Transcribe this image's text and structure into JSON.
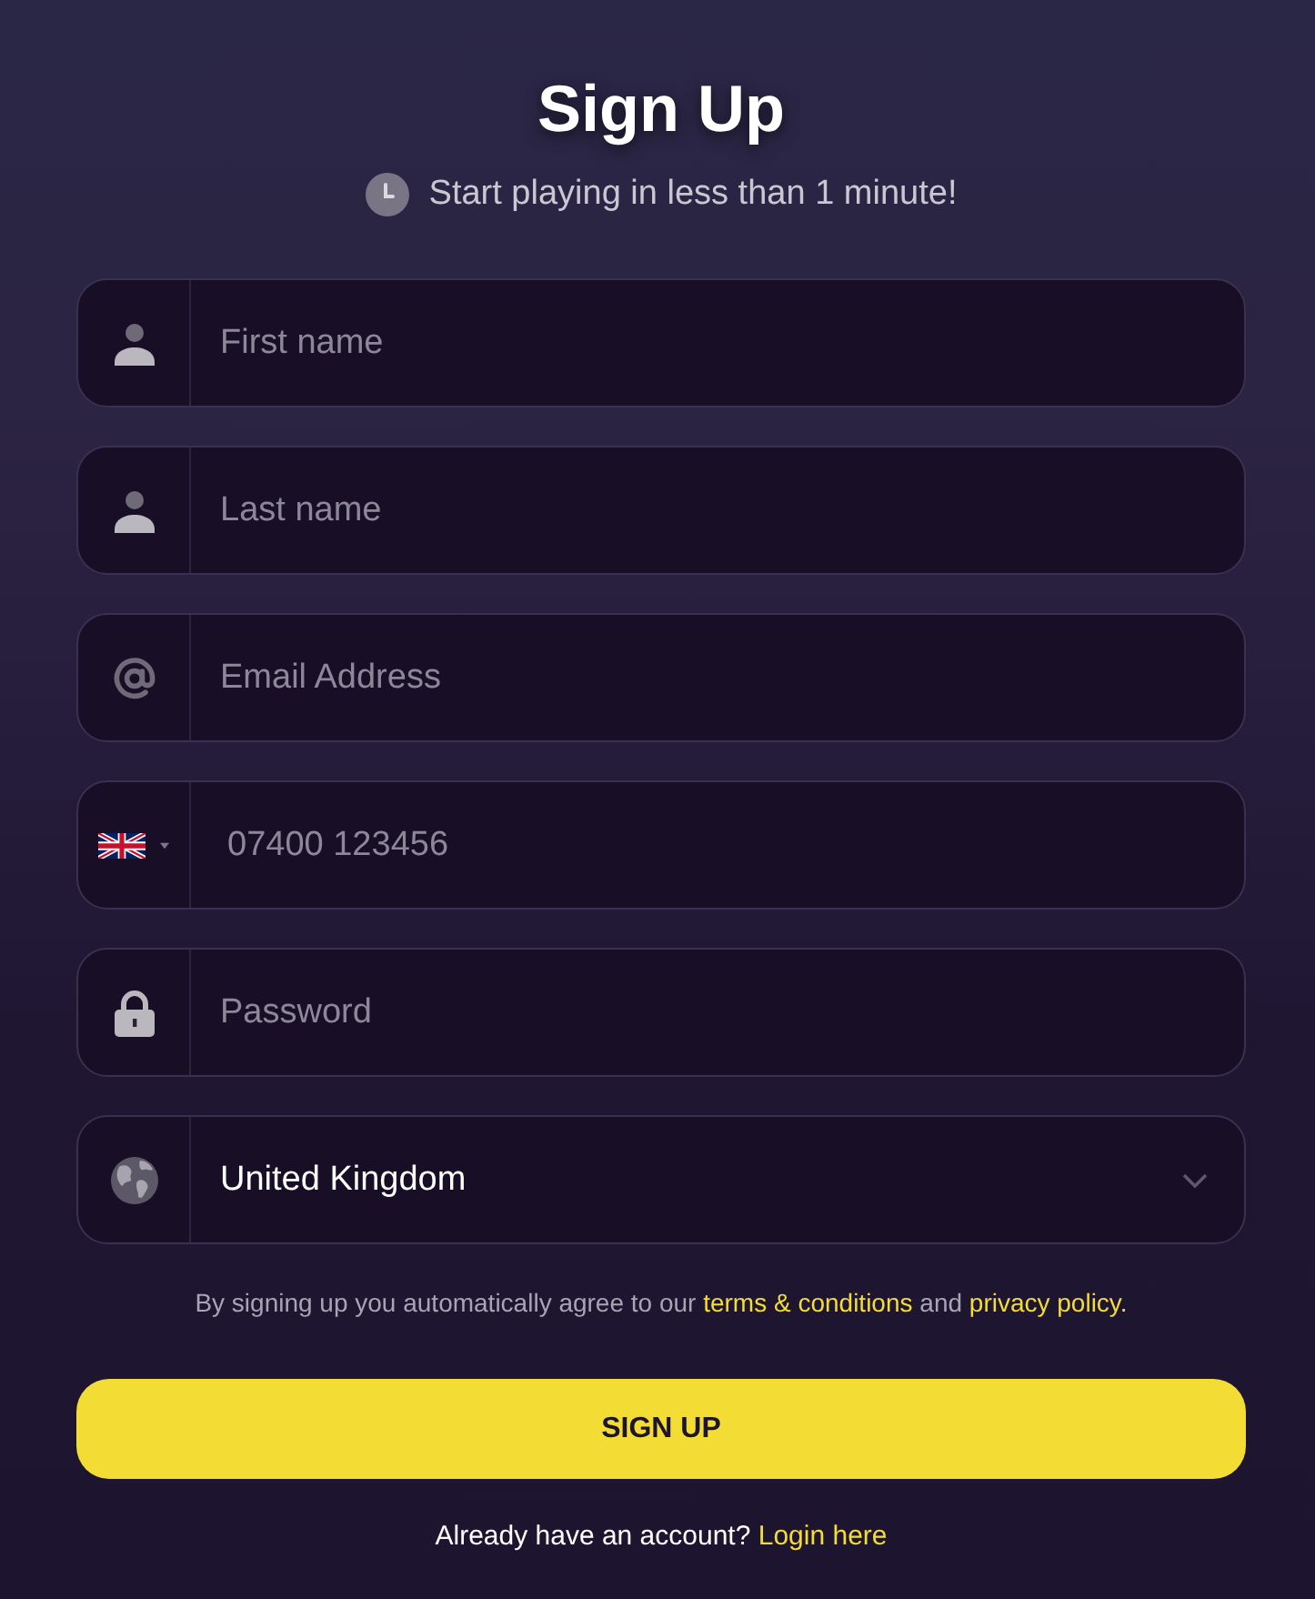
{
  "title": "Sign Up",
  "subtitle": "Start playing in less than 1 minute!",
  "fields": [
    {
      "kind": "name",
      "placeholder": "First name"
    },
    {
      "kind": "name",
      "placeholder": "Last name"
    },
    {
      "kind": "email",
      "placeholder": "Email Address"
    },
    {
      "kind": "phone",
      "placeholder": "07400 123456"
    },
    {
      "kind": "password",
      "placeholder": "Password"
    },
    {
      "kind": "country",
      "value": "United Kingdom"
    }
  ],
  "agreement": [
    {
      "kind": "text",
      "text": "By signing up you automatically agree to our"
    },
    {
      "kind": "link",
      "text": "terms & conditions"
    },
    {
      "kind": "text",
      "text": "and"
    },
    {
      "kind": "link",
      "text": "privacy policy."
    }
  ],
  "submit_button": "SIGN UP",
  "login_prompt": {
    "question": "Already have an account?",
    "link": "Login here"
  }
}
